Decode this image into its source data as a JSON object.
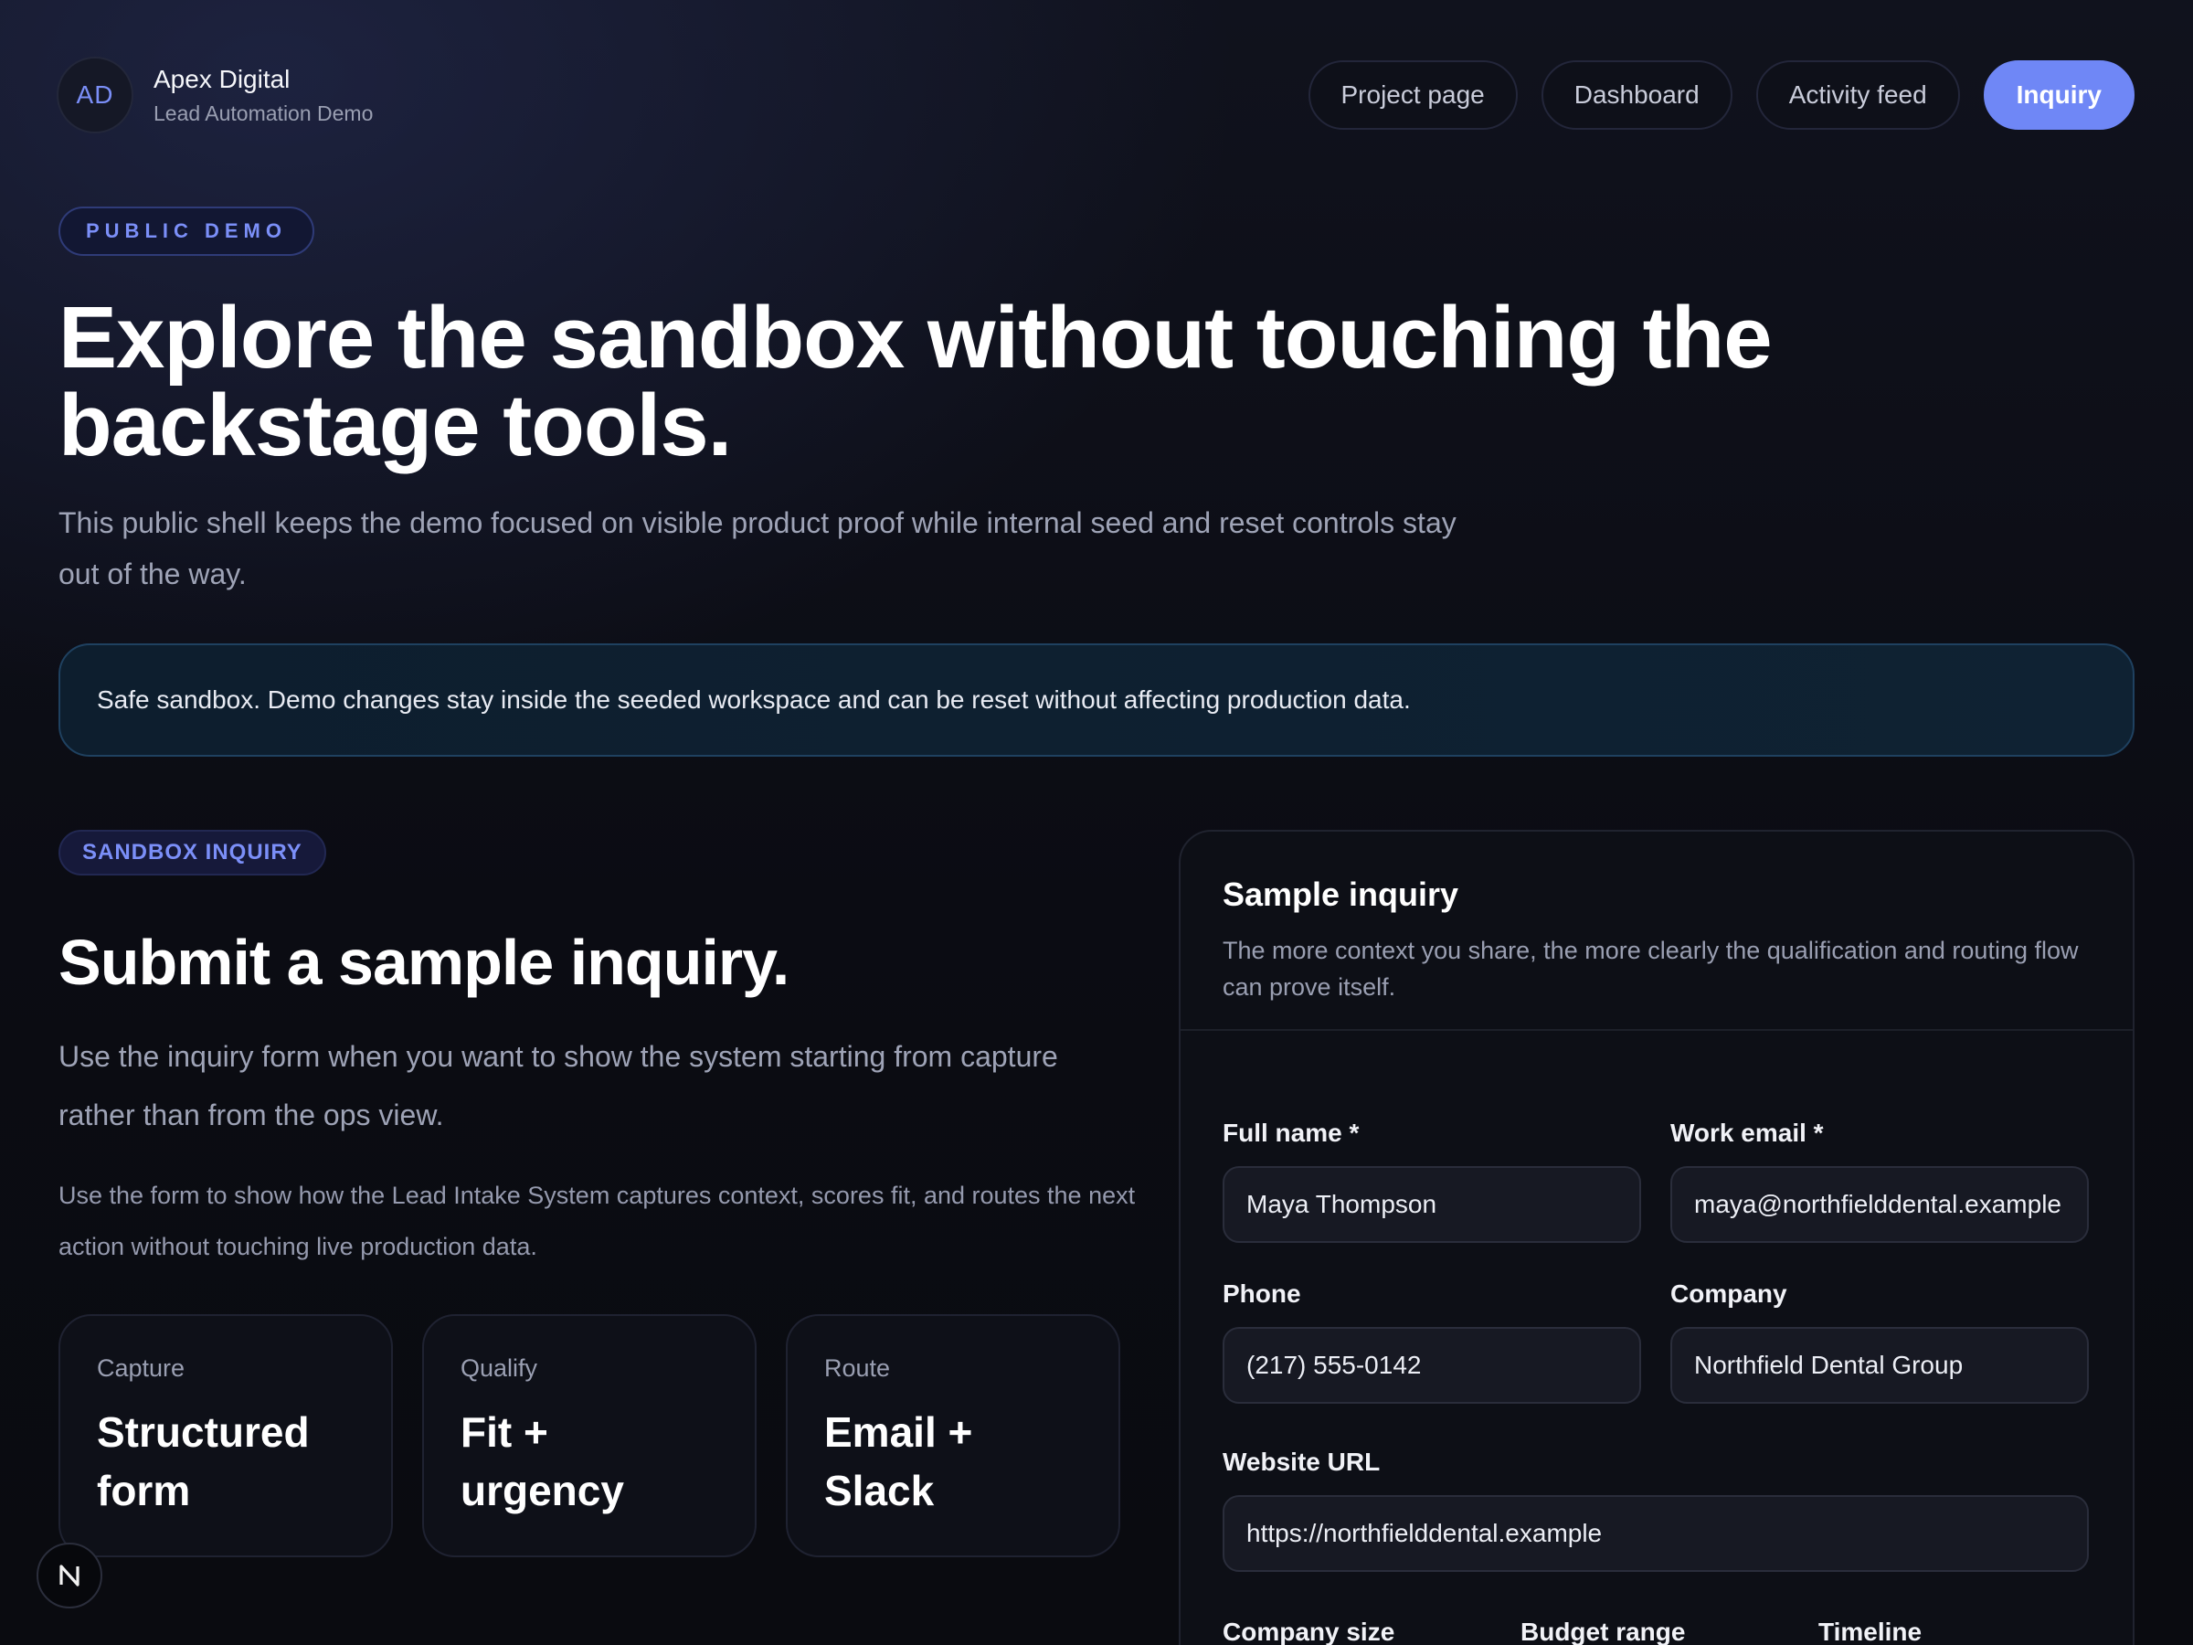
{
  "brand": {
    "initials": "AD",
    "name": "Apex Digital",
    "subtitle": "Lead Automation Demo"
  },
  "nav": {
    "items": [
      {
        "label": "Project page",
        "active": false
      },
      {
        "label": "Dashboard",
        "active": false
      },
      {
        "label": "Activity feed",
        "active": false
      },
      {
        "label": "Inquiry",
        "active": true
      }
    ]
  },
  "hero": {
    "tag": "PUBLIC DEMO",
    "title": "Explore the sandbox without touching the backstage tools.",
    "subtitle": "This public shell keeps the demo focused on visible product proof while internal seed and reset controls stay out of the way."
  },
  "notice": {
    "text": "Safe sandbox. Demo changes stay inside the seeded workspace and can be reset without affecting production data."
  },
  "section": {
    "tag": "SANDBOX INQUIRY",
    "title": "Submit a sample inquiry.",
    "lead": "Use the inquiry form when you want to show the system starting from capture rather than from the ops view.",
    "body": "Use the form to show how the Lead Intake System captures context, scores fit, and routes the next action without touching live production data."
  },
  "steps": [
    {
      "label": "Capture",
      "value": "Structured form"
    },
    {
      "label": "Qualify",
      "value": "Fit + urgency"
    },
    {
      "label": "Route",
      "value": "Email + Slack"
    }
  ],
  "form": {
    "title": "Sample inquiry",
    "description": "The more context you share, the more clearly the qualification and routing flow can prove itself.",
    "full_name": {
      "label": "Full name *",
      "value": "Maya Thompson"
    },
    "work_email": {
      "label": "Work email *",
      "value": "maya@northfielddental.example"
    },
    "phone": {
      "label": "Phone",
      "value": "(217) 555-0142"
    },
    "company": {
      "label": "Company",
      "value": "Northfield Dental Group"
    },
    "website": {
      "label": "Website URL",
      "value": "https://northfielddental.example"
    },
    "company_size": {
      "label": "Company size"
    },
    "budget_range": {
      "label": "Budget range"
    },
    "timeline": {
      "label": "Timeline"
    }
  },
  "colors": {
    "accent": "#6f87f6",
    "background": "#0a0b10",
    "notice_bg": "#0f2233"
  },
  "icons": {
    "dev_badge": "next-n-icon"
  }
}
